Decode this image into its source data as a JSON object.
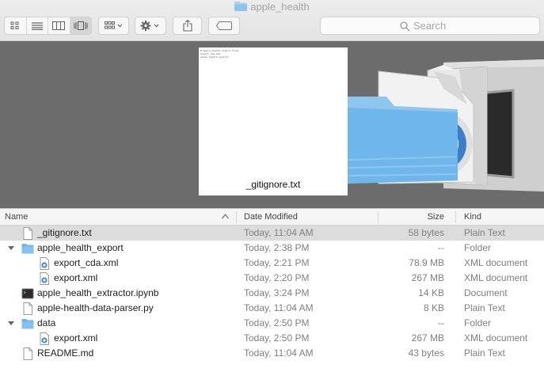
{
  "window": {
    "title": "apple_health"
  },
  "toolbar": {
    "view_modes": [
      "icon-view",
      "list-view",
      "column-view",
      "cover-flow-view"
    ],
    "active_view": "cover-flow-view",
    "search_placeholder": "Search"
  },
  "preview": {
    "caption": "_gitignore.txt",
    "doc_lines": [
      "#-apple-health-export-files",
      "export_cda.xml",
      "apple_health_export/"
    ]
  },
  "columns": {
    "name": "Name",
    "date": "Date Modified",
    "size": "Size",
    "kind": "Kind"
  },
  "rows": [
    {
      "name": "_gitignore.txt",
      "date": "Today, 11:04 AM",
      "size": "58 bytes",
      "kind": "Plain Text",
      "icon": "text-file-icon",
      "level": 0,
      "selected": true
    },
    {
      "name": "apple_health_export",
      "date": "Today, 2:38 PM",
      "size": "--",
      "kind": "Folder",
      "icon": "folder-icon",
      "level": 0,
      "expanded": true
    },
    {
      "name": "export_cda.xml",
      "date": "Today, 2:21 PM",
      "size": "78.9 MB",
      "kind": "XML document",
      "icon": "xml-file-icon",
      "level": 1
    },
    {
      "name": "export.xml",
      "date": "Today, 2:20 PM",
      "size": "267 MB",
      "kind": "XML document",
      "icon": "xml-file-icon",
      "level": 1
    },
    {
      "name": "apple_health_extractor.ipynb",
      "date": "Today, 3:24 PM",
      "size": "14 KB",
      "kind": "Document",
      "icon": "terminal-document-icon",
      "level": 0
    },
    {
      "name": "apple-health-data-parser.py",
      "date": "Today, 11:04 AM",
      "size": "8 KB",
      "kind": "Plain Text",
      "icon": "text-file-icon",
      "level": 0
    },
    {
      "name": "data",
      "date": "Today, 2:50 PM",
      "size": "--",
      "kind": "Folder",
      "icon": "folder-icon",
      "level": 0,
      "expanded": true
    },
    {
      "name": "export.xml",
      "date": "Today, 2:50 PM",
      "size": "267 MB",
      "kind": "XML document",
      "icon": "xml-file-icon",
      "level": 1
    },
    {
      "name": "README.md",
      "date": "Today, 11:04 AM",
      "size": "43 bytes",
      "kind": "Plain Text",
      "icon": "text-file-icon",
      "level": 0
    }
  ]
}
